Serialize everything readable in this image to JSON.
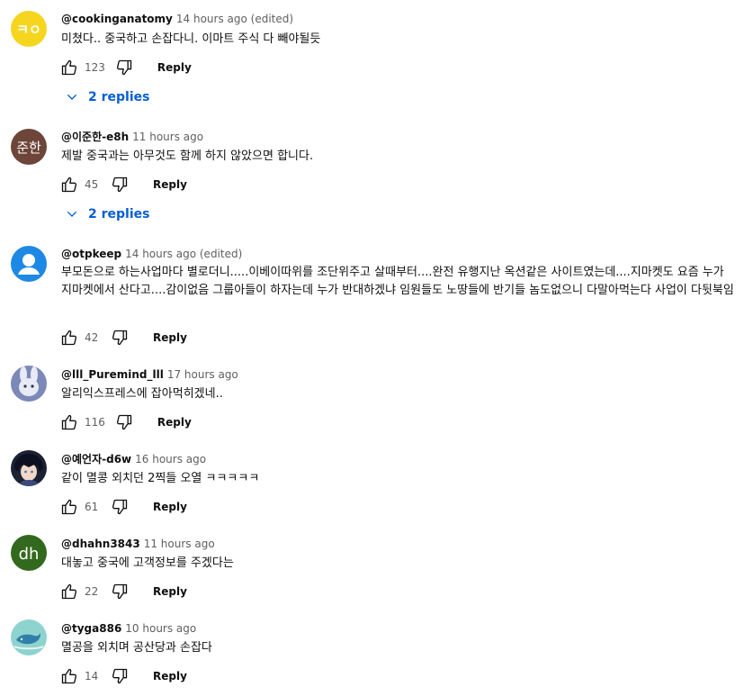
{
  "colors": {
    "replies_link": "#065fd4",
    "secondary_text": "#606060",
    "primary_text": "#0f0f0f"
  },
  "comments": [
    {
      "author": "@cookinganatomy",
      "time": "14 hours ago (edited)",
      "text": "미쳤다.. 중국하고 손잡다니. 이마트 주식 다 빼야될듯",
      "likes": "123",
      "reply_label": "Reply",
      "replies_label": "2 replies",
      "avatar": {
        "kind": "logo",
        "bg": "#f6d51f",
        "text": "ㅋㅇ"
      }
    },
    {
      "author": "@이준한-e8h",
      "time": "11 hours ago",
      "text": "제발 중국과는 아무것도 함께 하지 않았으면 합니다.",
      "likes": "45",
      "reply_label": "Reply",
      "replies_label": "2 replies",
      "avatar": {
        "kind": "initials",
        "bg": "#6d4539",
        "text": "준한"
      }
    },
    {
      "author": "@otpkeep",
      "time": "14 hours ago (edited)",
      "text": "부모돈으로 하는사업마다 별로더니.....이베이따위를 조단위주고 살때부터....완전 유행지난 옥션같은 사이트였는데....지마켓도 요즘 누가 지마켓에서 산다고....감이없음 그룹아들이 하자는데 누가 반대하겠냐 임원들도 노땅들에 반기들 놈도없으니 다말아먹는다 사업이 다뒷북임",
      "likes": "42",
      "reply_label": "Reply",
      "avatar": {
        "kind": "default",
        "bg": "#1e88e5"
      }
    },
    {
      "author": "@lll_Puremind_lll",
      "time": "17 hours ago",
      "text": "알리익스프레스에 잡아먹히겠네..",
      "likes": "116",
      "reply_label": "Reply",
      "avatar": {
        "kind": "image",
        "bg": "#7b88b8",
        "icon": "rabbit-character-icon"
      }
    },
    {
      "author": "@예언자-d6w",
      "time": "16 hours ago",
      "text": "같이 멸콩 외치던 2찍들 오열 ㅋㅋㅋㅋㅋ",
      "likes": "61",
      "reply_label": "Reply",
      "avatar": {
        "kind": "image",
        "bg": "#1c2233",
        "icon": "anime-character-icon"
      }
    },
    {
      "author": "@dhahn3843",
      "time": "11 hours ago",
      "text": "대놓고 중국에 고객정보를 주겠다는",
      "likes": "22",
      "reply_label": "Reply",
      "avatar": {
        "kind": "initials",
        "bg": "#33691e",
        "text": "dh"
      }
    },
    {
      "author": "@tyga886",
      "time": "10 hours ago",
      "text": "멸공을 외치며 공산당과 손잡다",
      "likes": "14",
      "reply_label": "Reply",
      "avatar": {
        "kind": "image",
        "bg": "#8fd3cf",
        "icon": "whale-icon"
      }
    }
  ]
}
